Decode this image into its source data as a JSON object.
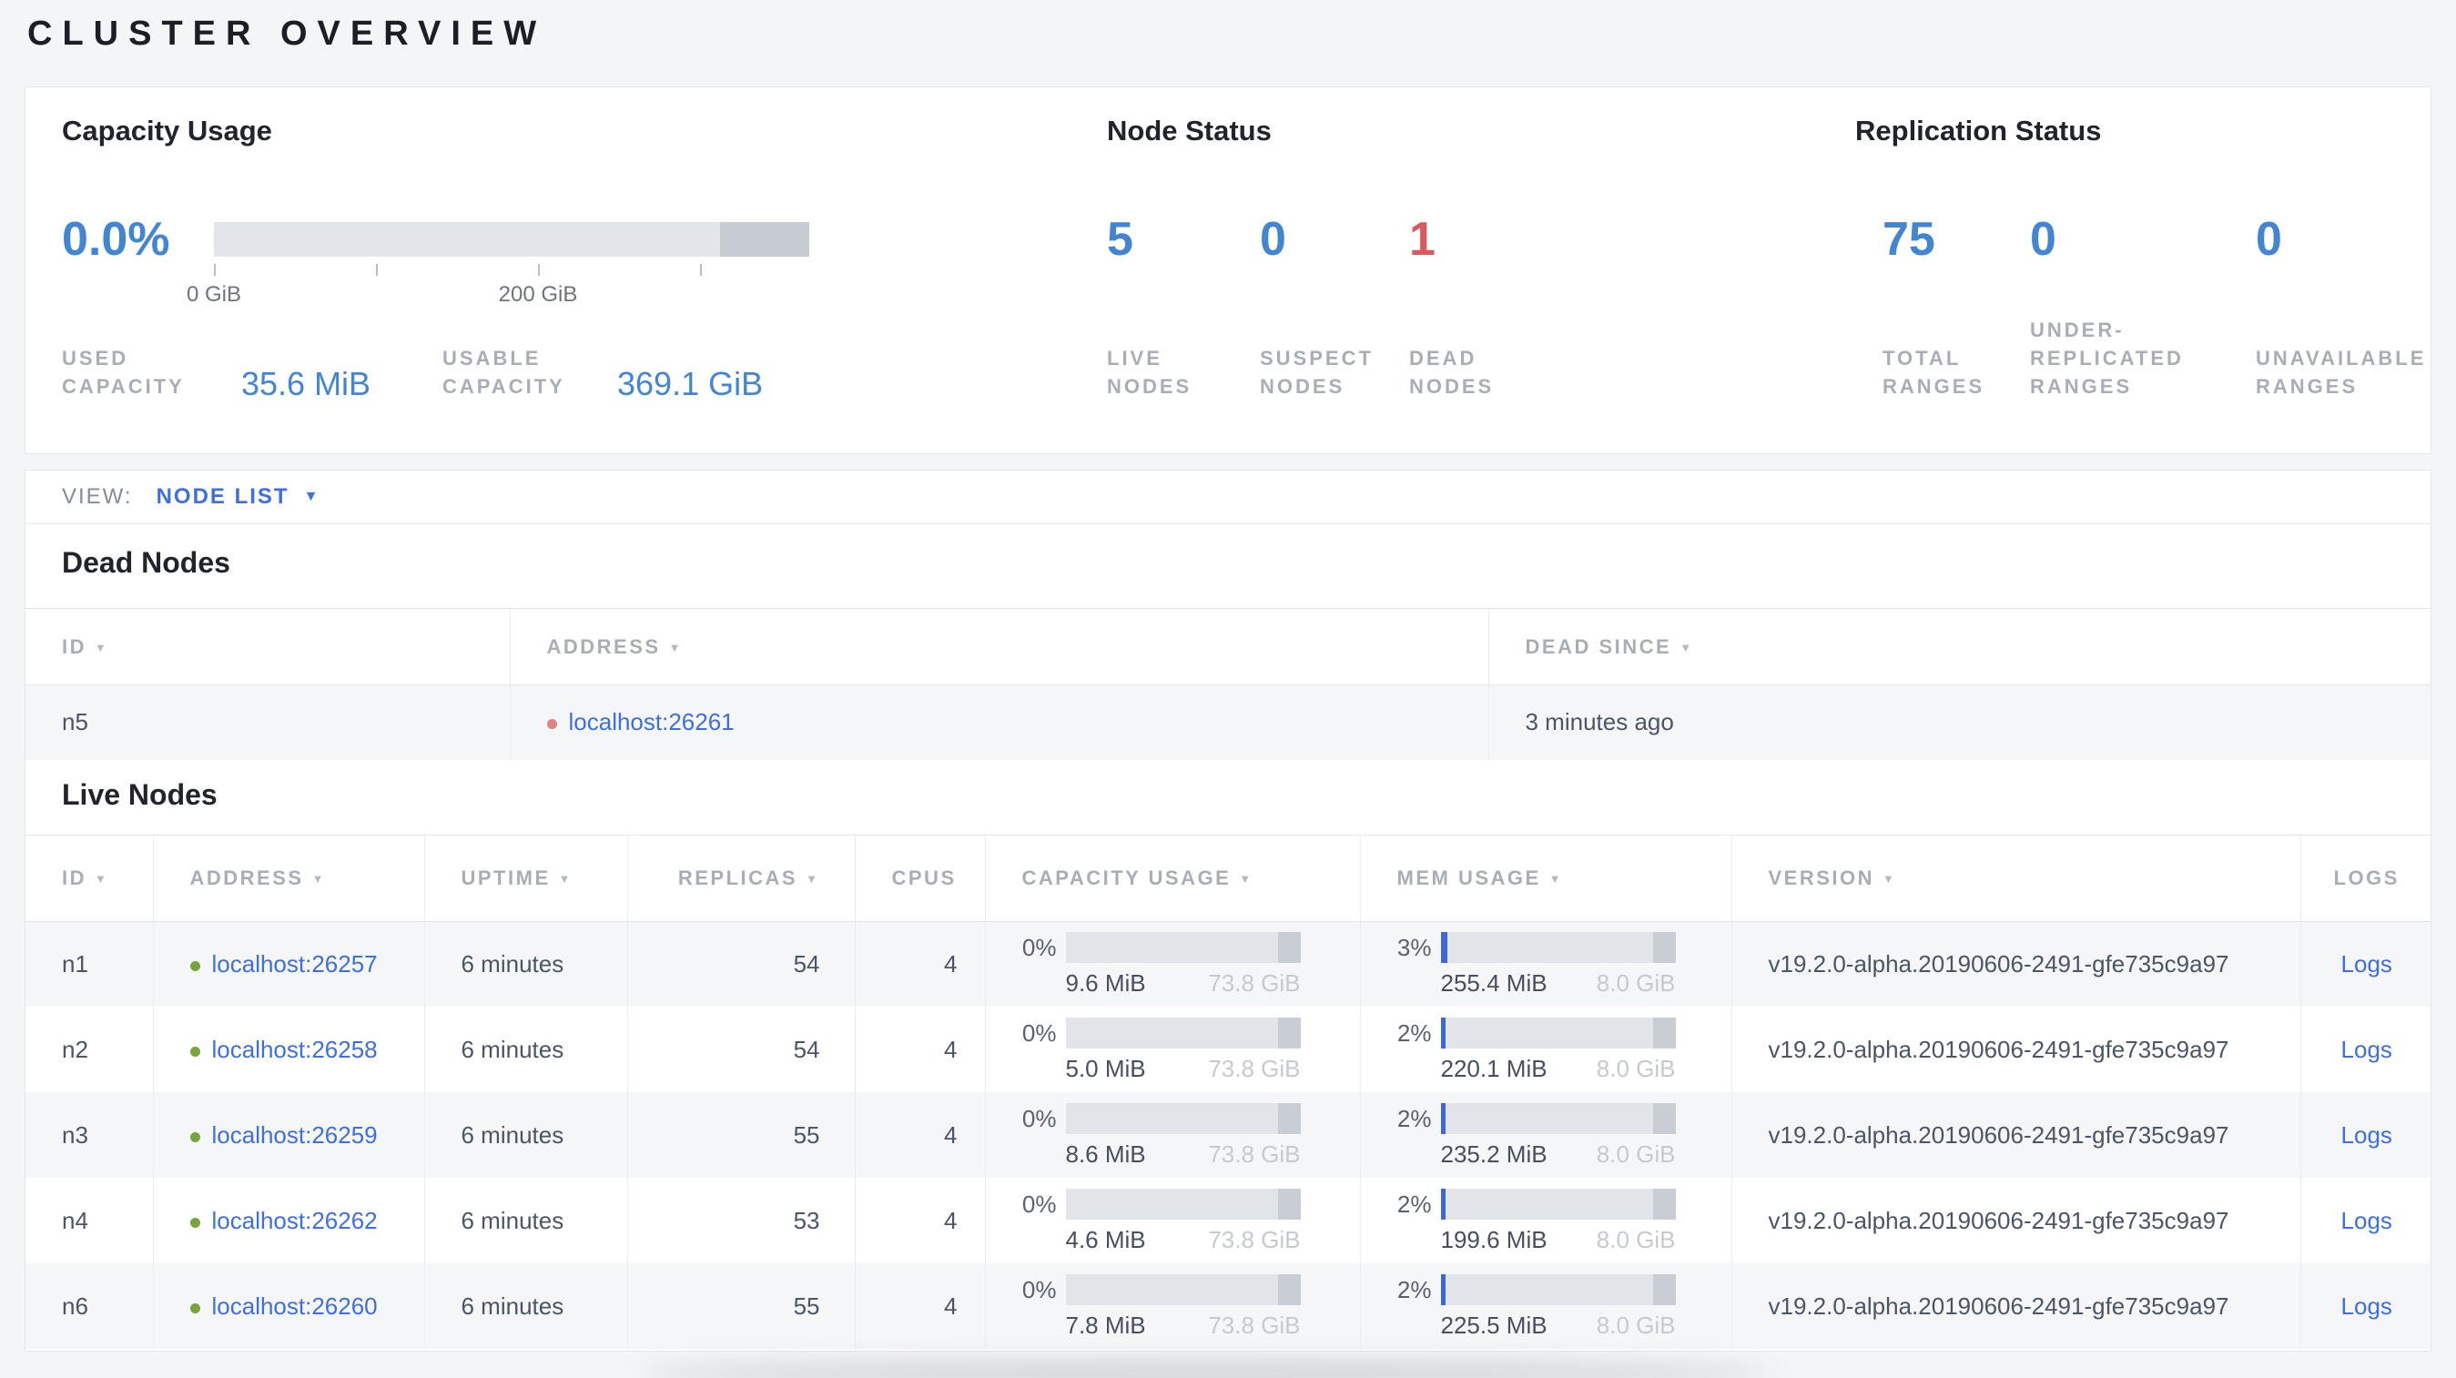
{
  "page": {
    "title": "CLUSTER OVERVIEW"
  },
  "ui": {
    "sort_arrow": "▼",
    "caret": "▼"
  },
  "summary": {
    "capacity": {
      "title": "Capacity Usage",
      "percent": "0.0%",
      "tick_labels": {
        "zero": "0 GiB",
        "two_hundred": "200 GiB"
      },
      "stats": {
        "used": {
          "line1": "USED",
          "line2": "CAPACITY",
          "value": "35.6 MiB"
        },
        "usable": {
          "line1": "USABLE",
          "line2": "CAPACITY",
          "value": "369.1 GiB"
        }
      }
    },
    "node_status": {
      "title": "Node Status",
      "live": {
        "value": "5",
        "line1": "LIVE",
        "line2": "NODES"
      },
      "suspect": {
        "value": "0",
        "line1": "SUSPECT",
        "line2": "NODES"
      },
      "dead": {
        "value": "1",
        "line1": "DEAD",
        "line2": "NODES"
      }
    },
    "replication": {
      "title": "Replication Status",
      "total": {
        "value": "75",
        "line1": "TOTAL",
        "line2": "RANGES"
      },
      "under": {
        "value": "0",
        "line1": "UNDER-",
        "line2": "REPLICATED",
        "line3": "RANGES"
      },
      "unavailable": {
        "value": "0",
        "line1": "UNAVAILABLE",
        "line2": "RANGES"
      }
    }
  },
  "view_bar": {
    "label": "VIEW:",
    "selected": "NODE LIST"
  },
  "dead_nodes": {
    "heading": "Dead Nodes",
    "columns": {
      "id": "ID",
      "address": "ADDRESS",
      "dead_since": "DEAD SINCE"
    },
    "rows": [
      {
        "id": "n5",
        "address": "localhost:26261",
        "dead_since": "3 minutes ago"
      }
    ]
  },
  "live_nodes": {
    "heading": "Live Nodes",
    "columns": {
      "id": "ID",
      "address": "ADDRESS",
      "uptime": "UPTIME",
      "replicas": "REPLICAS",
      "cpus": "CPUS",
      "capacity": "CAPACITY USAGE",
      "mem": "MEM USAGE",
      "version": "VERSION",
      "logs": "LOGS"
    },
    "rows": [
      {
        "id": "n1",
        "address": "localhost:26257",
        "uptime": "6 minutes",
        "replicas": "54",
        "cpus": "4",
        "cap_pct": "0%",
        "cap_used": "9.6 MiB",
        "cap_total": "73.8 GiB",
        "mem_pct": "3%",
        "mem_used": "255.4 MiB",
        "mem_total": "8.0 GiB",
        "version": "v19.2.0-alpha.20190606-2491-gfe735c9a97",
        "logs": "Logs"
      },
      {
        "id": "n2",
        "address": "localhost:26258",
        "uptime": "6 minutes",
        "replicas": "54",
        "cpus": "4",
        "cap_pct": "0%",
        "cap_used": "5.0 MiB",
        "cap_total": "73.8 GiB",
        "mem_pct": "2%",
        "mem_used": "220.1 MiB",
        "mem_total": "8.0 GiB",
        "version": "v19.2.0-alpha.20190606-2491-gfe735c9a97",
        "logs": "Logs"
      },
      {
        "id": "n3",
        "address": "localhost:26259",
        "uptime": "6 minutes",
        "replicas": "55",
        "cpus": "4",
        "cap_pct": "0%",
        "cap_used": "8.6 MiB",
        "cap_total": "73.8 GiB",
        "mem_pct": "2%",
        "mem_used": "235.2 MiB",
        "mem_total": "8.0 GiB",
        "version": "v19.2.0-alpha.20190606-2491-gfe735c9a97",
        "logs": "Logs"
      },
      {
        "id": "n4",
        "address": "localhost:26262",
        "uptime": "6 minutes",
        "replicas": "53",
        "cpus": "4",
        "cap_pct": "0%",
        "cap_used": "4.6 MiB",
        "cap_total": "73.8 GiB",
        "mem_pct": "2%",
        "mem_used": "199.6 MiB",
        "mem_total": "8.0 GiB",
        "version": "v19.2.0-alpha.20190606-2491-gfe735c9a97",
        "logs": "Logs"
      },
      {
        "id": "n6",
        "address": "localhost:26260",
        "uptime": "6 minutes",
        "replicas": "55",
        "cpus": "4",
        "cap_pct": "0%",
        "cap_used": "7.8 MiB",
        "cap_total": "73.8 GiB",
        "mem_pct": "2%",
        "mem_used": "225.5 MiB",
        "mem_total": "8.0 GiB",
        "version": "v19.2.0-alpha.20190606-2491-gfe735c9a97",
        "logs": "Logs"
      }
    ]
  },
  "colors": {
    "accent_blue": "#4285d3",
    "link_blue": "#3e6fdd",
    "status_red": "#d9595f",
    "live_green": "#76a53c",
    "dead_red_dot": "#e0807f",
    "bar_track": "#e1e4e9",
    "bar_other": "#c9cdd4",
    "bar_fill_blue": "#3e66d4"
  }
}
